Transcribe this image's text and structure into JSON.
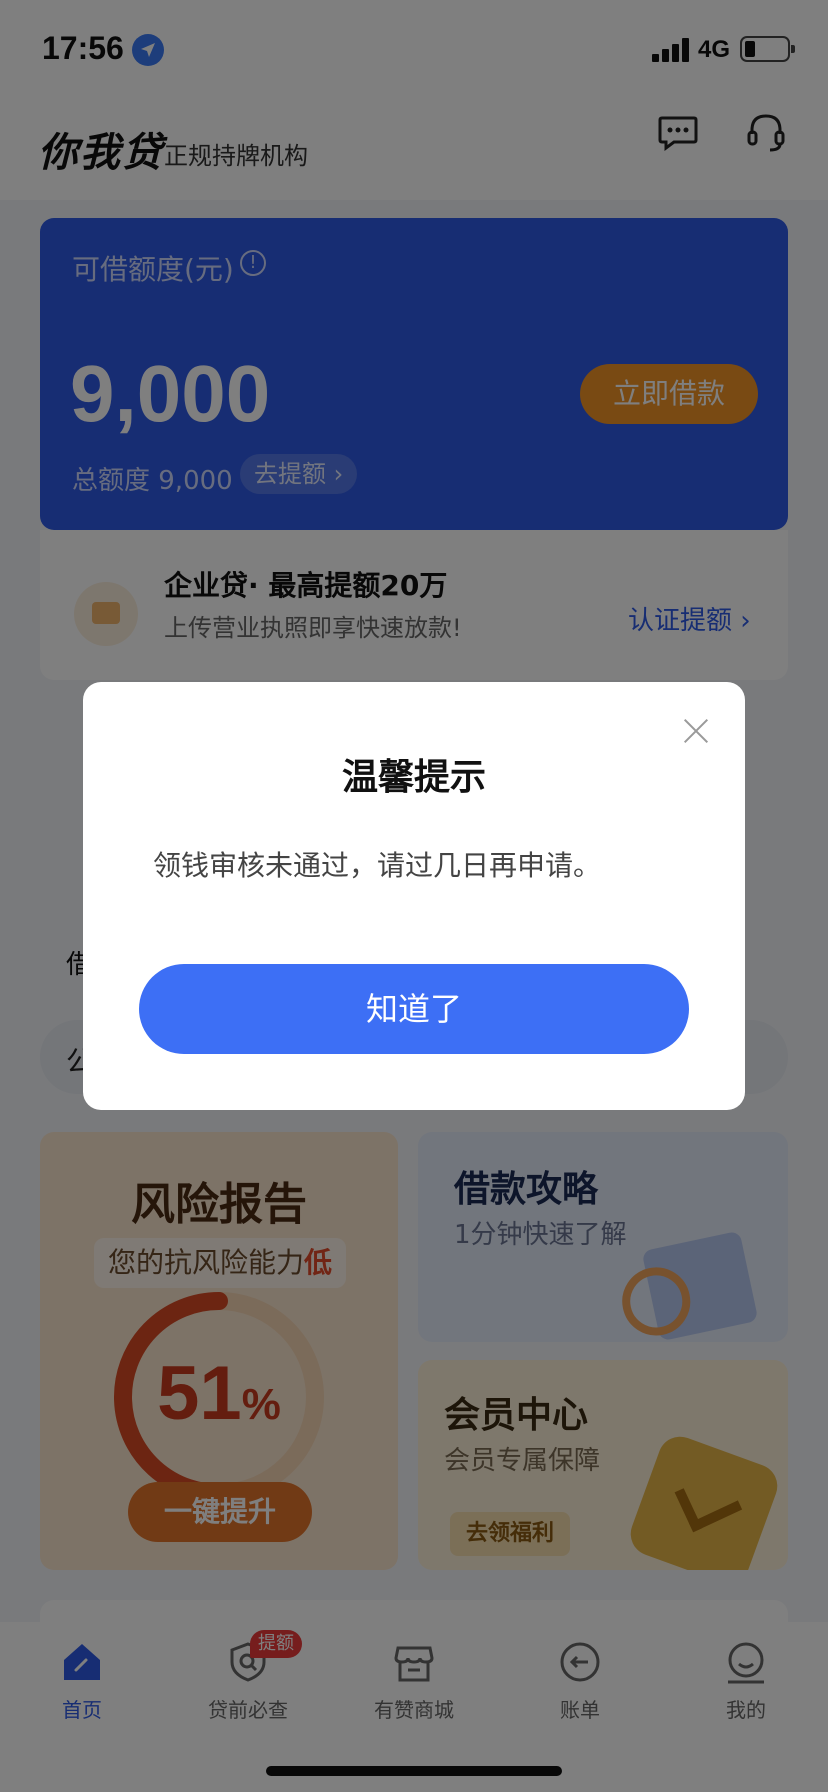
{
  "status_bar": {
    "time": "17:56",
    "network": "4G"
  },
  "header": {
    "brand": "你我贷",
    "subtitle": "正规持牌机构",
    "icons": [
      "message-icon",
      "headset-icon"
    ]
  },
  "credit_card": {
    "label": "可借额度(元)",
    "amount": "9,000",
    "borrow_button": "立即借款",
    "total_label": "总额度 9,000",
    "raise_button": "去提额 ›",
    "color": "#2f5be6",
    "button_color": "#f29427"
  },
  "business_loan": {
    "title": "企业贷· 最高提额20万",
    "subtitle": "上传营业执照即享快速放款!",
    "link": "认证提额 ›"
  },
  "middle": {
    "text_fragment": "借",
    "search_fragment": "公"
  },
  "risk_report": {
    "title": "风险报告",
    "badge_prefix": "您的抗风险能力",
    "badge_level": "低",
    "percent": "51",
    "percent_unit": "%",
    "percent_value": 51,
    "button": "一键提升"
  },
  "loan_guide": {
    "title": "借款攻略",
    "subtitle": "1分钟快速了解"
  },
  "vip_center": {
    "title": "会员中心",
    "subtitle": "会员专属保障",
    "button": "去领福利"
  },
  "tab_bar": {
    "items": [
      {
        "label": "首页",
        "icon": "home-icon",
        "active": true
      },
      {
        "label": "贷前必查",
        "icon": "shield-search-icon",
        "active": false
      },
      {
        "label": "有赞商城",
        "icon": "store-icon",
        "active": false
      },
      {
        "label": "账单",
        "icon": "bill-icon",
        "active": false
      },
      {
        "label": "我的",
        "icon": "profile-icon",
        "active": false
      }
    ],
    "badge": "提额",
    "accent": "#2f5be6"
  },
  "dialog": {
    "title": "温馨提示",
    "message": "领钱审核未通过，请过几日再申请。",
    "confirm_button": "知道了",
    "button_color": "#3d6ff5"
  }
}
